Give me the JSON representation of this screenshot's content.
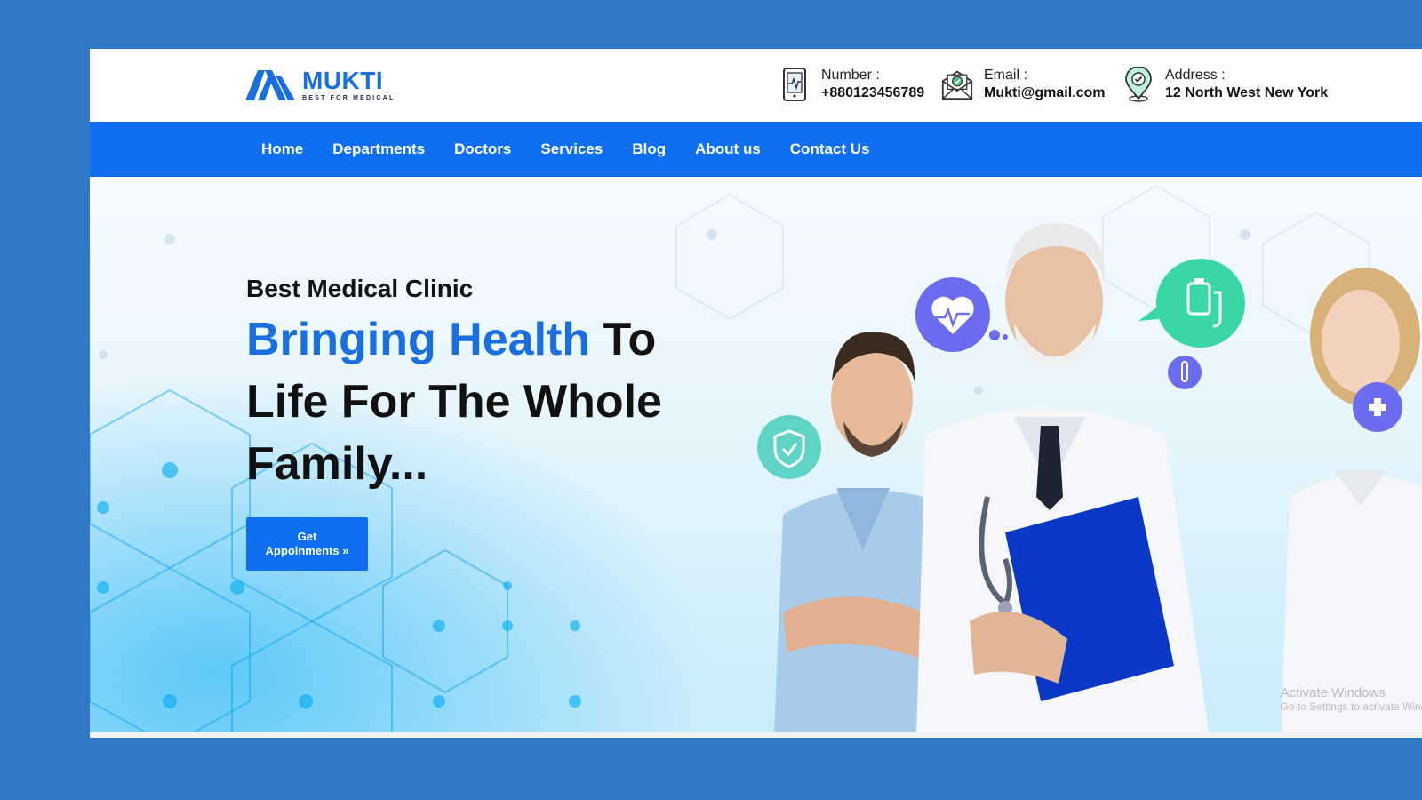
{
  "brand": {
    "name": "MUKTI",
    "tagline": "BEST FOR MEDICAL",
    "color": "#1a6fe0"
  },
  "contacts": [
    {
      "label": "Number :",
      "value": "+880123456789",
      "icon": "phone-tablet-icon"
    },
    {
      "label": "Email :",
      "value": "Mukti@gmail.com",
      "icon": "envelope-check-icon"
    },
    {
      "label": "Address :",
      "value": "12 North West New York",
      "icon": "map-pin-check-icon"
    }
  ],
  "nav": {
    "items": [
      "Home",
      "Departments",
      "Doctors",
      "Services",
      "Blog",
      "About us",
      "Contact Us"
    ],
    "color": "#0e6ff0"
  },
  "hero": {
    "subtitle": "Best Medical Clinic",
    "title_highlight": "Bringing Health",
    "title_rest": " To Life For The Whole Family...",
    "cta_line1": "Get",
    "cta_line2": "Appoinments »"
  },
  "watermark": {
    "line1": "Activate Windows",
    "line2": "Go to Settings to activate Windows."
  },
  "colors": {
    "page_bg": "#3079c8",
    "accent": "#0e6ff0",
    "heart_badge": "#6b6cf0",
    "teal_badge": "#45d6b4"
  }
}
